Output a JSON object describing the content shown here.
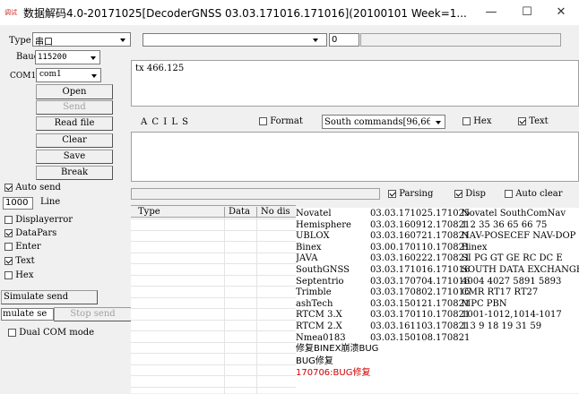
{
  "window": {
    "app_icon": "app-icon",
    "app_icon_text": "调试",
    "title": "数据解码4.0-20171025[DecoderGNSS  03.03.171016.171016](20100101 Week=1...",
    "minimize": "—",
    "maximize": "☐",
    "close": "✕"
  },
  "controls": {
    "type_label": "Type",
    "type_value": "串口",
    "baud_label": "Baud",
    "baud_value": "115200",
    "com_label": "COM1",
    "com_value": "com1",
    "buttons": {
      "open": "Open",
      "send": "Send",
      "read_file": "Read file",
      "clear": "Clear",
      "save": "Save",
      "break": "Break"
    },
    "auto_send": "Auto send",
    "line_count": "1000",
    "line_label": "Line",
    "display_error": "Displayerror",
    "data_pars": "DataPars",
    "enter": "Enter",
    "text": "Text",
    "hex": "Hex",
    "simulate_send": "Simulate send",
    "simulate_partial": "mulate se",
    "stop_send": "Stop send",
    "dual_com": "Dual COM mode"
  },
  "top_bar": {
    "combo_value": "",
    "num_value": "0"
  },
  "send_area": {
    "text": "tx 466.125"
  },
  "middle_bar": {
    "acils": "A C I L S",
    "format": "Format",
    "south_combo": "South commands[96,66",
    "hex": "Hex",
    "text": "Text"
  },
  "parse_bar": {
    "parsing": "Parsing",
    "disp": "Disp",
    "auto_clear": "Auto clear"
  },
  "table": {
    "headers": [
      "Type",
      "Data",
      "No dis"
    ]
  },
  "decoders": [
    {
      "name": "Novatel",
      "version": "03.03.171025.171025",
      "info": "Novatel SouthComNav"
    },
    {
      "name": "Hemisphere",
      "version": "03.03.160912.170821",
      "info": "1 2 35 36 65 66 75"
    },
    {
      "name": "UBLOX",
      "version": "03.03.160721.170821",
      "info": "NAV-POSECEF NAV-DOP"
    },
    {
      "name": "Binex",
      "version": "03.00.170110.170821",
      "info": "Binex"
    },
    {
      "name": "JAVA",
      "version": "03.03.160222.170821",
      "info": "SI PG GT GE RC DC E"
    },
    {
      "name": "SouthGNSS",
      "version": "03.03.171016.171016",
      "info": "SOUTH DATA EXCHANGE"
    },
    {
      "name": "Septentrio",
      "version": "03.03.170704.171016",
      "info": "4004 4027 5891 5893"
    },
    {
      "name": "Trimble",
      "version": "03.03.170802.171016",
      "info": "CMR RT17 RT27"
    },
    {
      "name": "ashTech",
      "version": "03.03.150121.170821",
      "info": "MPC PBN"
    },
    {
      "name": "RTCM 3.X",
      "version": "03.03.170110.170821",
      "info": "1001-1012,1014-1017"
    },
    {
      "name": "RTCM 2.X",
      "version": "03.03.161103.170821",
      "info": "1 3 9 18 19 31 59"
    },
    {
      "name": "Nmea0183",
      "version": "03.03.150108.170821",
      "info": ""
    }
  ],
  "notes": [
    {
      "text": "修复BINEX崩溃BUG",
      "color": "#000000"
    },
    {
      "text": "BUG修复",
      "color": "#000000"
    },
    {
      "text": "170706:BUG修复",
      "color": "#d00000"
    }
  ]
}
